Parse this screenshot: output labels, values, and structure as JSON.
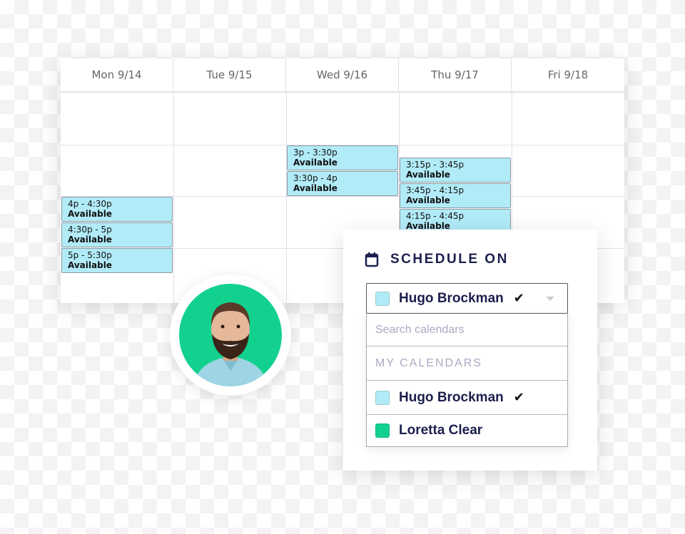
{
  "calendar": {
    "days": [
      "Mon 9/14",
      "Tue 9/15",
      "Wed 9/16",
      "Thu 9/17",
      "Fri 9/18"
    ],
    "slots": [
      {
        "day": "Mon 9/14",
        "time": "4p - 4:30p",
        "status": "Available"
      },
      {
        "day": "Mon 9/14",
        "time": "4:30p - 5p",
        "status": "Available"
      },
      {
        "day": "Mon 9/14",
        "time": "5p - 5:30p",
        "status": "Available"
      },
      {
        "day": "Wed 9/16",
        "time": "3p - 3:30p",
        "status": "Available"
      },
      {
        "day": "Wed 9/16",
        "time": "3:30p - 4p",
        "status": "Available"
      },
      {
        "day": "Thu 9/17",
        "time": "3:15p - 3:45p",
        "status": "Available"
      },
      {
        "day": "Thu 9/17",
        "time": "3:45p - 4:15p",
        "status": "Available"
      },
      {
        "day": "Thu 9/17",
        "time": "4:15p - 4:45p",
        "status": "Available"
      }
    ],
    "slot_color": "#b2ebf8"
  },
  "avatar": {
    "bg_color": "#12d18e"
  },
  "schedule": {
    "title": "SCHEDULE ON",
    "selected": {
      "name": "Hugo Brockman",
      "color": "#b2ebf8",
      "checked": true
    },
    "search_placeholder": "Search calendars",
    "section": "MY CALENDARS",
    "calendars": [
      {
        "name": "Hugo Brockman",
        "color": "#b2ebf8",
        "checked": true
      },
      {
        "name": "Loretta Clear",
        "color": "#12d18e",
        "checked": false
      }
    ]
  }
}
